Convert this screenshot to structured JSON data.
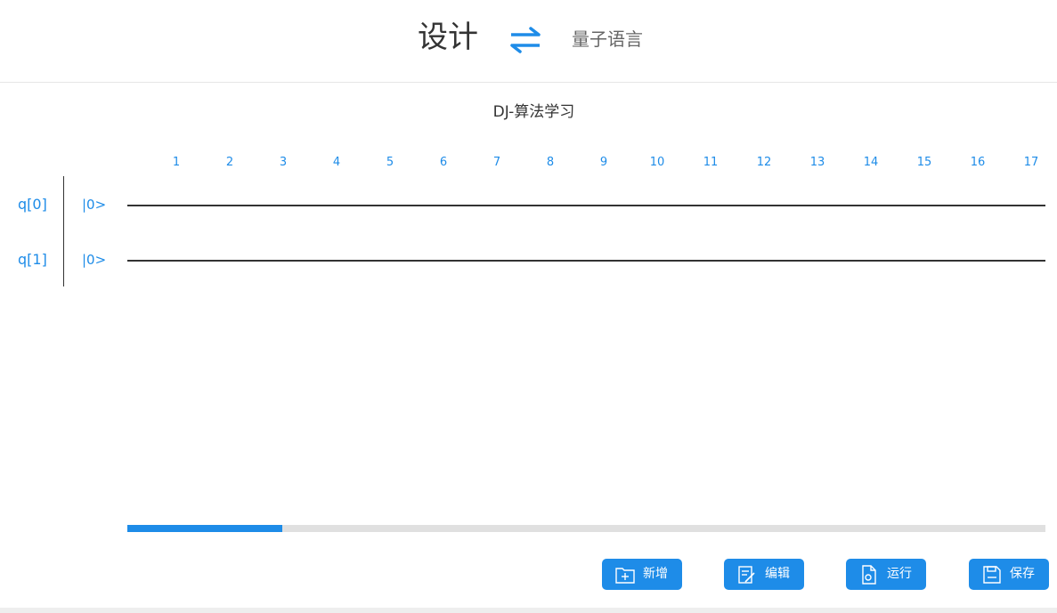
{
  "header": {
    "design_label": "设计",
    "swap_icon": "swap-arrows-icon",
    "language_label": "量子语言"
  },
  "circuit": {
    "title": "DJ-算法学习",
    "columns": [
      "1",
      "2",
      "3",
      "4",
      "5",
      "6",
      "7",
      "8",
      "9",
      "10",
      "11",
      "12",
      "13",
      "14",
      "15",
      "16",
      "17"
    ],
    "qubits": [
      {
        "label": "q[0]",
        "init": "|0>"
      },
      {
        "label": "q[1]",
        "init": "|0>"
      }
    ]
  },
  "scrollbar": {
    "position_fraction": 0.169
  },
  "actions": {
    "add_label": "新增",
    "edit_label": "编辑",
    "run_label": "运行",
    "save_label": "保存"
  },
  "colors": {
    "accent": "#1e8ce8",
    "text": "#333333",
    "wire": "#333333",
    "track": "#e0e0e0"
  }
}
